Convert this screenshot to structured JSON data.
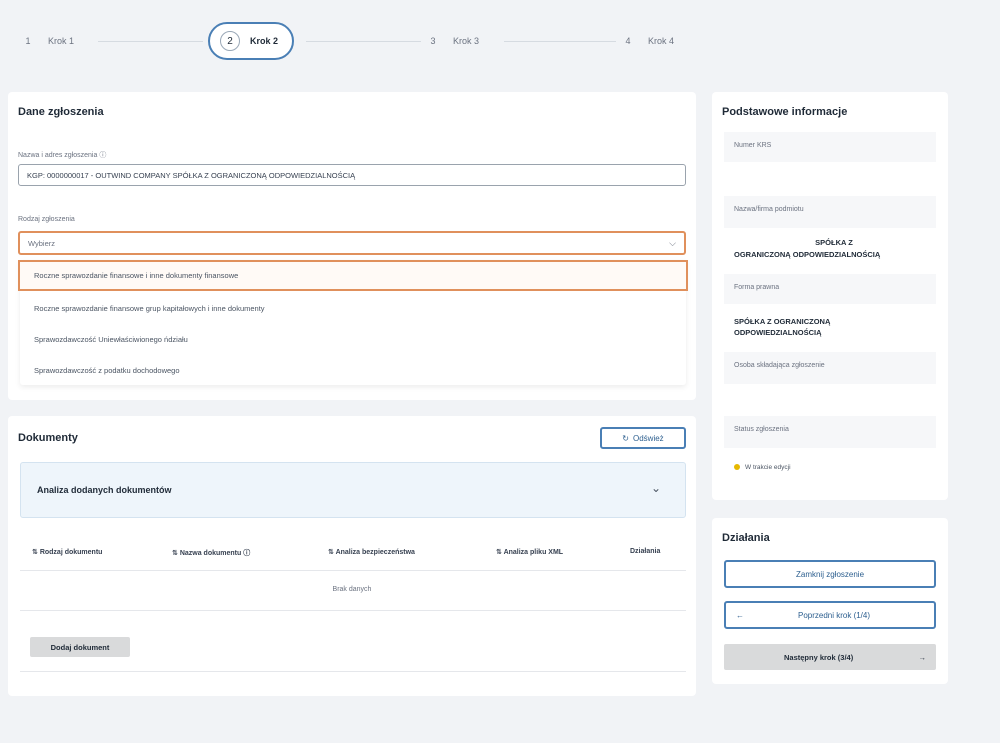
{
  "stepper": {
    "steps": [
      {
        "num": "1",
        "label": "Krok 1"
      },
      {
        "num": "2",
        "label": "Krok 2"
      },
      {
        "num": "3",
        "label": "Krok 3"
      },
      {
        "num": "4",
        "label": "Krok 4"
      }
    ],
    "active_index": 1
  },
  "form": {
    "title": "Dane zgłoszenia",
    "owner_label": "Nazwa i adres zgłoszenia ⓘ",
    "owner_value": "KGP: 0000000017 - OUTWIND COMPANY SPÓŁKA Z OGRANICZONĄ ODPOWIEDZIALNOŚCIĄ",
    "type_label": "Rodzaj zgłoszenia",
    "type_placeholder": "Wybierz",
    "options": [
      "Roczne sprawozdanie finansowe i inne dokumenty finansowe",
      "Roczne sprawozdanie finansowe grup kapitałowych i inne dokumenty",
      "Sprawozdawczość Uniewłaściwionego ńdziału",
      "Sprawozdawczość z podatku dochodowego"
    ]
  },
  "info": {
    "title": "Podstawowe informacje",
    "krs_label": "Numer KRS",
    "name_label": "Nazwa/firma podmiotu",
    "name_value_line1": "SPÓŁKA Z",
    "name_value_line2": "OGRANICZONĄ ODPOWIEDZIALNOŚCIĄ",
    "legal_label": "Forma prawna",
    "legal_value": "SPÓŁKA Z OGRANICZONĄ ODPOWIEDZIALNOŚCIĄ",
    "submitter_label": "Osoba składająca zgłoszenie",
    "status_label": "Status zgłoszenia",
    "status_value": "W trakcie edycji",
    "status_color": "#e6b800"
  },
  "documents": {
    "title": "Dokumenty",
    "refresh_label": "Odśwież",
    "accordion_title": "Analiza dodanych dokumentów",
    "columns": [
      "Rodzaj dokumentu",
      "Nazwa dokumentu ⓘ",
      "Analiza bezpieczeństwa",
      "Analiza pliku XML",
      "Działania"
    ],
    "empty_text": "Brak danych",
    "add_label": "Dodaj dokument"
  },
  "actions": {
    "title": "Działania",
    "save_label": "Zamknij zgłoszenie",
    "prev_label": "Poprzedni krok (1/4)",
    "next_label": "Następny krok (3/4)"
  },
  "colors": {
    "accent": "#4a7fb5",
    "highlight": "#e0905c",
    "background": "#f1f3f6"
  }
}
